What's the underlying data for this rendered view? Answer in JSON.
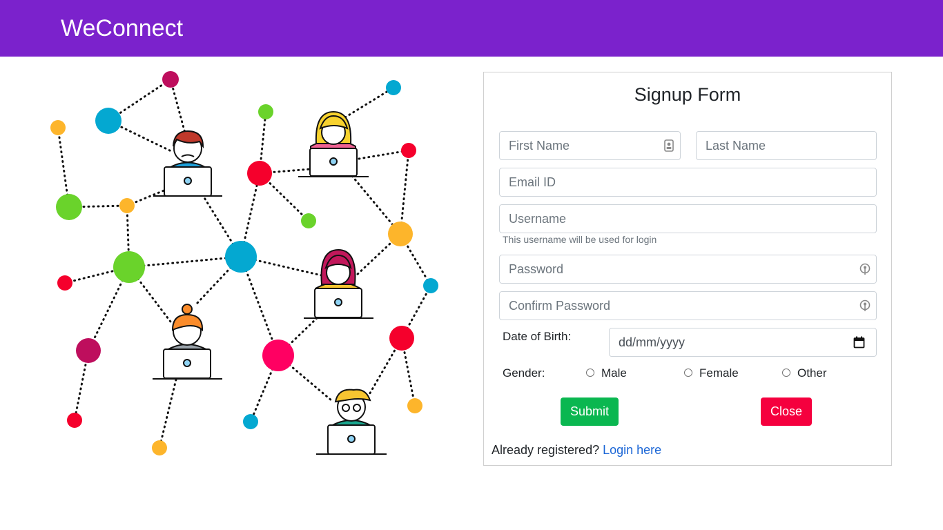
{
  "header": {
    "brand": "WeConnect"
  },
  "form": {
    "title": "Signup Form",
    "first_name_placeholder": "First Name",
    "last_name_placeholder": "Last Name",
    "email_placeholder": "Email ID",
    "username_placeholder": "Username",
    "username_help": "This username will be used for login",
    "password_placeholder": "Password",
    "confirm_password_placeholder": "Confirm Password",
    "dob_label": "Date of Birth:",
    "dob_placeholder": "dd/mm/yyyy",
    "gender_label": "Gender:",
    "gender_options": [
      "Male",
      "Female",
      "Other"
    ],
    "submit_label": "Submit",
    "close_label": "Close",
    "already_text": "Already registered?",
    "login_link": "Login here"
  },
  "colors": {
    "navbar": "#7b22cc",
    "submit": "#0ab750",
    "close": "#f5003e",
    "link": "#1b66d6"
  }
}
